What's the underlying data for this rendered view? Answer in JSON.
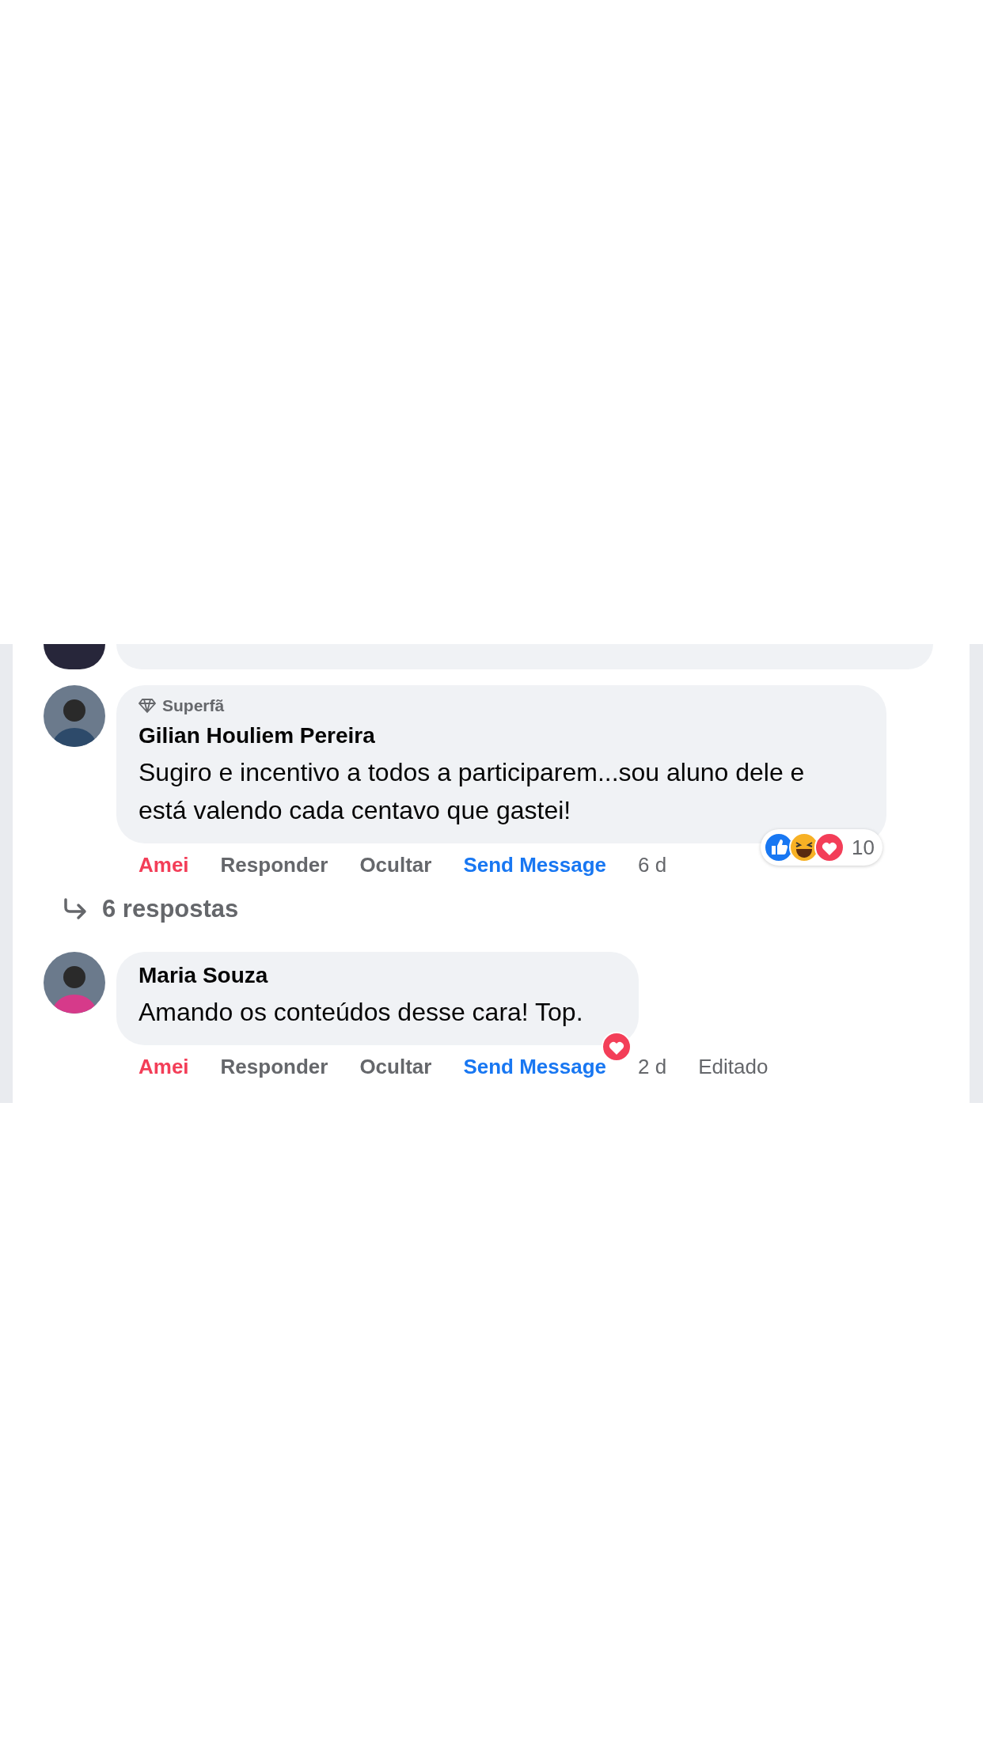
{
  "comments": [
    {
      "badge": "Superfã",
      "author": "Gilian Houliem Pereira",
      "text": "Sugiro e incentivo a todos a participarem...sou aluno dele e está valendo cada centavo que gastei!",
      "reactions": [
        {
          "kind": "like"
        },
        {
          "kind": "haha"
        },
        {
          "kind": "love"
        }
      ],
      "reaction_count": "10",
      "actions": [
        {
          "label": "Amei",
          "kind": "reaction",
          "selected": true
        },
        {
          "label": "Responder",
          "kind": "plain"
        },
        {
          "label": "Ocultar",
          "kind": "plain"
        },
        {
          "label": "Send Message",
          "kind": "message"
        }
      ],
      "time": "6 d",
      "replies": "6 respostas"
    },
    {
      "author": "Maria Souza",
      "text": "Amando os conteúdos desse cara! Top.",
      "reactions": [
        {
          "kind": "love"
        }
      ],
      "actions": [
        {
          "label": "Amei",
          "kind": "reaction",
          "selected": true
        },
        {
          "label": "Responder",
          "kind": "plain"
        },
        {
          "label": "Ocultar",
          "kind": "plain"
        },
        {
          "label": "Send Message",
          "kind": "message"
        }
      ],
      "time": "2 d",
      "edited": "Editado"
    }
  ]
}
